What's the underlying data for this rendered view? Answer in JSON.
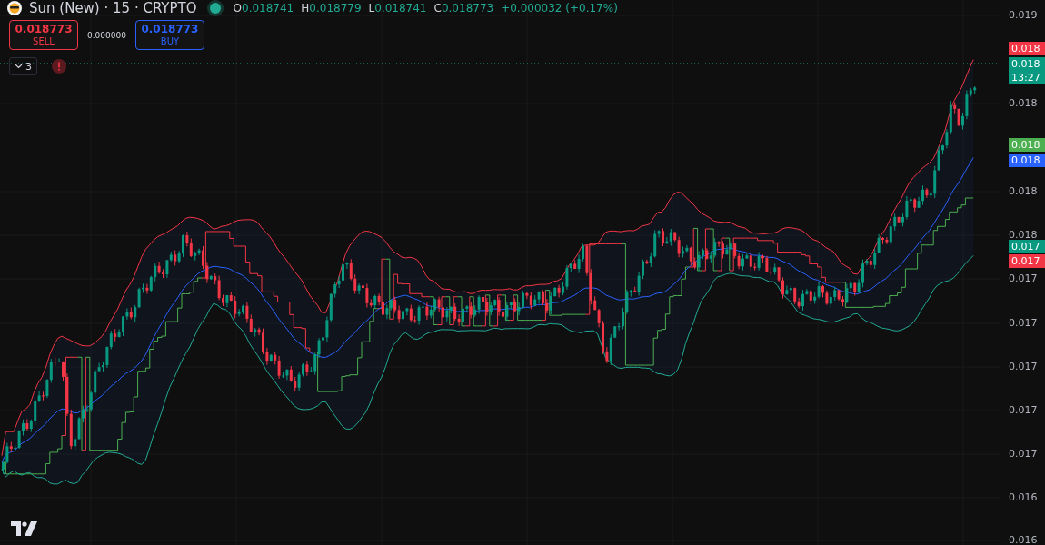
{
  "symbol": {
    "title": "Sun (New) · 15 · CRYPTO",
    "market_open": true,
    "ohlc": [
      {
        "label": "O",
        "value": "0.018741"
      },
      {
        "label": "H",
        "value": "0.018779"
      },
      {
        "label": "L",
        "value": "0.018741"
      },
      {
        "label": "C",
        "value": "0.018773"
      }
    ],
    "change": "+0.000032 (+0.17%)"
  },
  "trade": {
    "sell": {
      "price": "0.018773",
      "label": "SELL"
    },
    "spread": "0.000000",
    "buy": {
      "price": "0.018773",
      "label": "BUY"
    }
  },
  "indicators": {
    "count": "3"
  },
  "price_axis": {
    "ticks": [
      "0.019",
      "0.018",
      "0.018",
      "0.018",
      "0.017",
      "0.017",
      "0.017",
      "0.017",
      "0.017",
      "0.016",
      "0.016"
    ]
  },
  "price_badges": [
    {
      "price": "0.018",
      "color": "#f23645"
    },
    {
      "price": "0.018",
      "countdown": "13:27",
      "color": "#089981"
    },
    {
      "price": "0.018",
      "color": "#4caf50"
    },
    {
      "price": "0.018",
      "color": "#2962ff"
    },
    {
      "price": "0.017",
      "color": "#089981"
    },
    {
      "price": "0.017",
      "color": "#f23645"
    }
  ]
}
